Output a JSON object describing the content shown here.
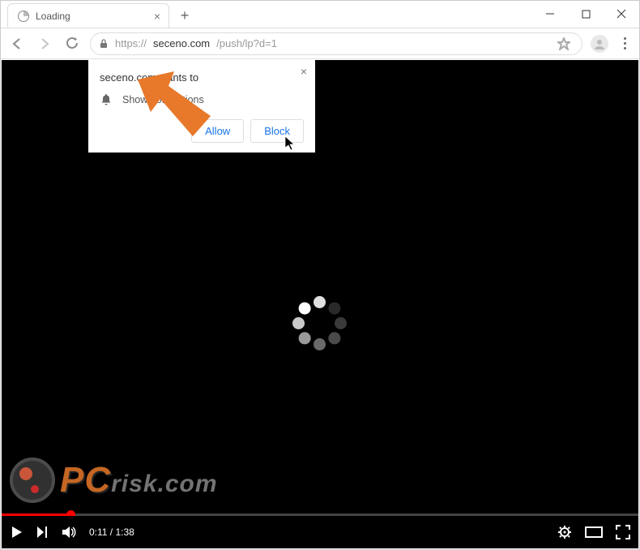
{
  "tab": {
    "title": "Loading"
  },
  "url": {
    "scheme": "https://",
    "domain": "seceno.com",
    "path": "/push/lp?d=1"
  },
  "permission_prompt": {
    "header": "seceno.com wants to",
    "item": "Show notifications",
    "allow": "Allow",
    "block": "Block"
  },
  "video": {
    "current_time": "0:11",
    "duration": "1:38"
  },
  "watermark": {
    "text_pc": "PC",
    "text_risk": "risk.com"
  }
}
